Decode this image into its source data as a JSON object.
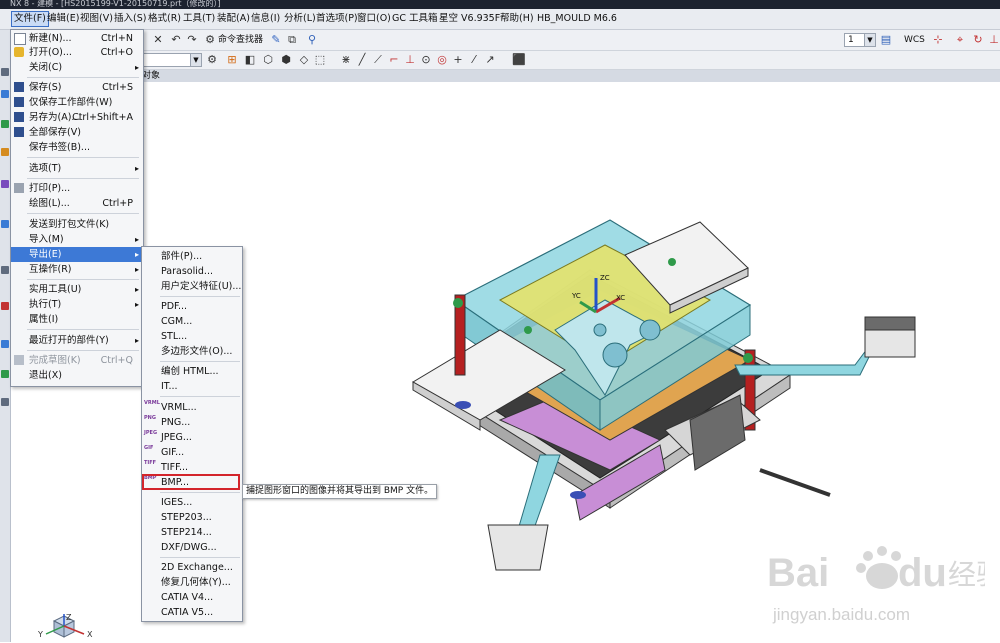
{
  "window": {
    "title": "NX 8 - 建模 - [HS2015199-V1-20150719.prt（修改的）]"
  },
  "menubar": {
    "items": [
      "文件(F)",
      "编辑(E)",
      "视图(V)",
      "插入(S)",
      "格式(R)",
      "工具(T)",
      "装配(A)",
      "信息(I)",
      "分析(L)",
      "首选项(P)",
      "窗口(O)",
      "GC 工具箱",
      "星空 V6.935F",
      "帮助(H)",
      "HB_MOULD M6.6"
    ],
    "active_index": 0
  },
  "toolbar": {
    "command_finder": "命令查找器",
    "layer_value": "1",
    "wcs_label": "WCS"
  },
  "graphics_header": {
    "label": "对象"
  },
  "file_menu": [
    {
      "label": "新建(N)...",
      "shortcut": "Ctrl+N"
    },
    {
      "label": "打开(O)...",
      "shortcut": "Ctrl+O"
    },
    {
      "label": "关闭(C)",
      "submenu": true
    },
    {
      "label": "保存(S)",
      "shortcut": "Ctrl+S"
    },
    {
      "label": "仅保存工作部件(W)"
    },
    {
      "label": "另存为(A)...",
      "shortcut": "Ctrl+Shift+A"
    },
    {
      "label": "全部保存(V)"
    },
    {
      "label": "保存书签(B)..."
    },
    {
      "label": "选项(T)",
      "submenu": true
    },
    {
      "label": "打印(P)..."
    },
    {
      "label": "绘图(L)...",
      "shortcut": "Ctrl+P"
    },
    {
      "label": "发送到打包文件(K)"
    },
    {
      "label": "导入(M)",
      "submenu": true
    },
    {
      "label": "导出(E)",
      "submenu": true
    },
    {
      "label": "互操作(R)",
      "submenu": true
    },
    {
      "label": "实用工具(U)",
      "submenu": true
    },
    {
      "label": "执行(T)",
      "submenu": true
    },
    {
      "label": "属性(I)"
    },
    {
      "label": "最近打开的部件(Y)",
      "submenu": true
    },
    {
      "label": "完成草图(K)",
      "shortcut": "Ctrl+Q"
    },
    {
      "label": "退出(X)"
    }
  ],
  "export_menu": [
    {
      "label": "部件(P)..."
    },
    {
      "label": "Parasolid..."
    },
    {
      "label": "用户定义特征(U)..."
    },
    {
      "label": "PDF..."
    },
    {
      "label": "CGM..."
    },
    {
      "label": "STL..."
    },
    {
      "label": "多边形文件(O)..."
    },
    {
      "label": "编创 HTML..."
    },
    {
      "label": "IT..."
    },
    {
      "label": "VRML...",
      "tag": "VRML"
    },
    {
      "label": "PNG...",
      "tag": "PNG"
    },
    {
      "label": "JPEG...",
      "tag": "JPEG"
    },
    {
      "label": "GIF...",
      "tag": "GIF"
    },
    {
      "label": "TIFF...",
      "tag": "TIFF"
    },
    {
      "label": "BMP...",
      "tag": "BMP"
    },
    {
      "label": "IGES..."
    },
    {
      "label": "STEP203..."
    },
    {
      "label": "STEP214..."
    },
    {
      "label": "DXF/DWG..."
    },
    {
      "label": "2D Exchange..."
    },
    {
      "label": "修复几何体(Y)..."
    },
    {
      "label": "CATIA V4..."
    },
    {
      "label": "CATIA V5..."
    }
  ],
  "tooltip": {
    "text": "捕捉图形窗口的图像并将其导出到 BMP 文件。"
  },
  "viewport": {
    "axis_labels": {
      "xc": "XC",
      "yc": "YC",
      "zc": "ZC"
    },
    "triad": {
      "x": "X",
      "y": "Y",
      "z": "Z"
    }
  },
  "watermark": {
    "brand": "Bai",
    "brand2": "du",
    "suffix": "经验",
    "url": "jingyan.baidu.com"
  },
  "colors": {
    "menu_highlight": "#3d79d6",
    "callout": "#d3242b",
    "model_plate": "#8fd6e0",
    "model_core": "#e4e26a"
  }
}
